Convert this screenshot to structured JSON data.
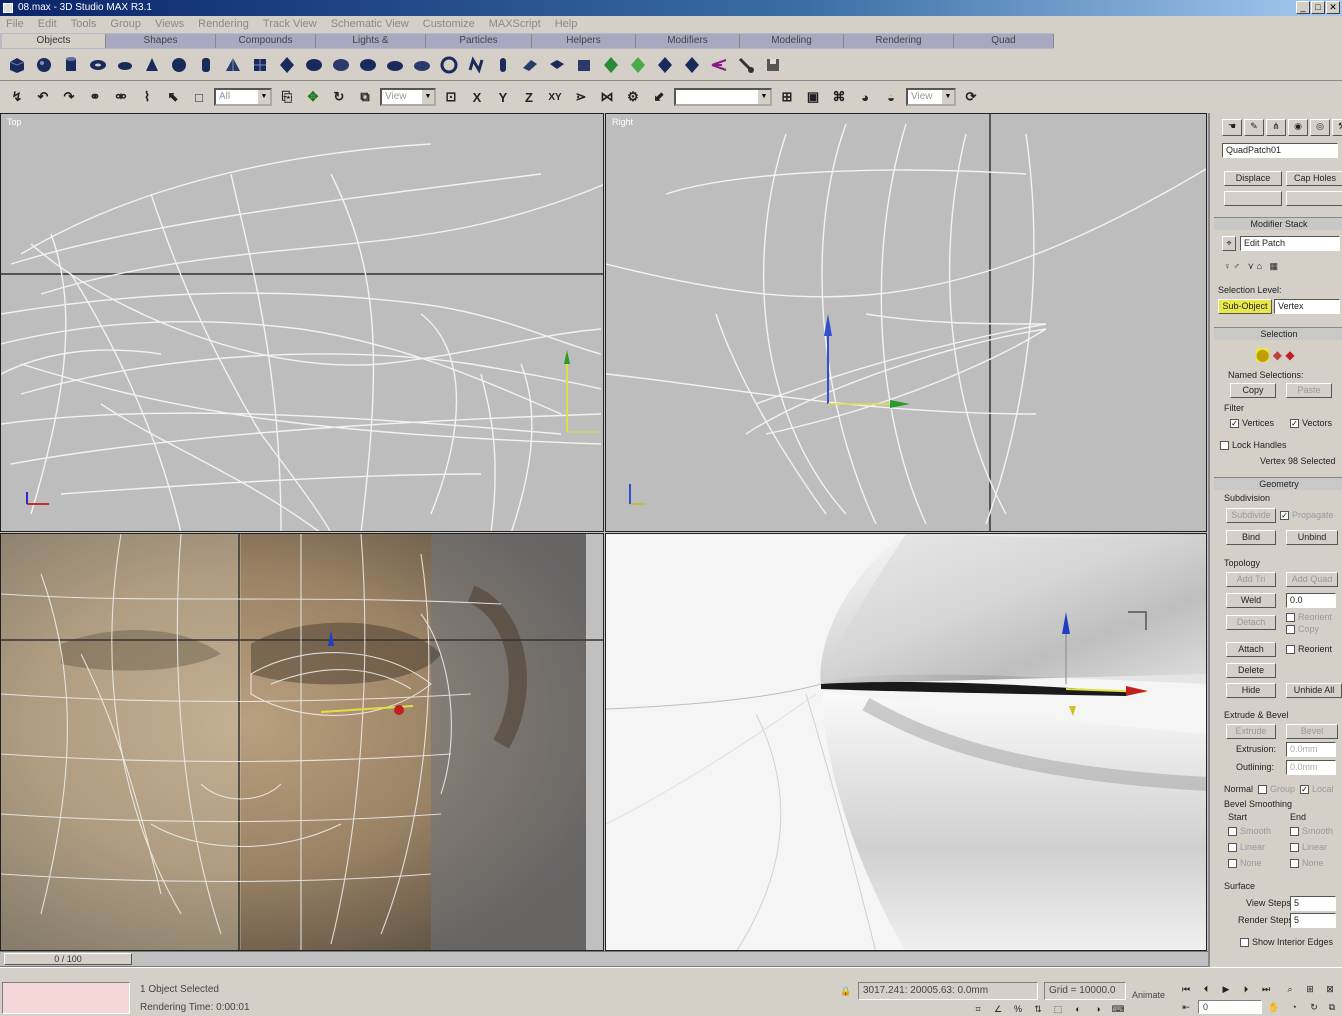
{
  "window": {
    "title": "08.max - 3D Studio MAX R3.1",
    "min": "_",
    "max": "□",
    "close": "✕"
  },
  "menu": [
    "File",
    "Edit",
    "Tools",
    "Group",
    "Views",
    "Rendering",
    "Track View",
    "Schematic View",
    "Customize",
    "MAXScript",
    "Help"
  ],
  "tabs": [
    "Objects",
    "Shapes",
    "Compounds",
    "Lights & Cameras",
    "Particles",
    "Helpers",
    "Modifiers",
    "Modeling",
    "Rendering",
    "Quad Meshes"
  ],
  "toolbar": {
    "selection_filter": "All",
    "ref_coord": "View",
    "named_sel": "",
    "view_dd": "View",
    "axis_x": "X",
    "axis_y": "Y",
    "axis_z": "Z",
    "axis_xy": "XY"
  },
  "viewports": {
    "top": "Top",
    "right": "Right",
    "front": "",
    "perspective": ""
  },
  "command_panel": {
    "object_name": "QuadPatch01",
    "displace": "Displace",
    "cap_holes": "Cap Holes",
    "modifier_stack_title": "Modifier Stack",
    "stack_item": "Edit Patch",
    "selection_level_label": "Selection Level:",
    "sub_object": "Sub-Object",
    "sub_level": "Vertex",
    "selection_title": "Selection",
    "named_selections": "Named Selections:",
    "copy": "Copy",
    "paste": "Paste",
    "filter": "Filter",
    "vertices": "Vertices",
    "vectors": "Vectors",
    "lock_handles": "Lock Handles",
    "vertex_selected": "Vertex 98 Selected",
    "geometry_title": "Geometry",
    "subdivision": "Subdivision",
    "subdivide": "Subdivide",
    "propagate": "Propagate",
    "bind": "Bind",
    "unbind": "Unbind",
    "topology": "Topology",
    "add_tri": "Add Tri",
    "add_quad": "Add Quad",
    "weld": "Weld",
    "weld_value": "0.0",
    "detach": "Detach",
    "reorient": "Reorient",
    "copy2": "Copy",
    "attach": "Attach",
    "reorient2": "Reorient",
    "delete": "Delete",
    "hide": "Hide",
    "unhide_all": "Unhide All",
    "extrude_bevel": "Extrude & Bevel",
    "extrude_btn": "Extrude",
    "bevel_btn": "Bevel",
    "extrusion": "Extrusion:",
    "extrusion_val": "0.0mm",
    "outlining": "Outlining:",
    "outlining_val": "0.0mm",
    "normal": "Normal",
    "group": "Group",
    "local": "Local",
    "bevel_smoothing": "Bevel Smoothing",
    "start": "Start",
    "end": "End",
    "smooth": "Smooth",
    "linear": "Linear",
    "none": "None",
    "surface": "Surface",
    "view_steps": "View Steps:",
    "view_steps_val": "5",
    "render_steps": "Render Steps:",
    "render_steps_val": "5",
    "show_interior_edges": "Show Interior Edges"
  },
  "timeline": {
    "position": "0 / 100"
  },
  "status": {
    "selected": "1 Object Selected",
    "render_time": "Rendering Time: 0:00:01",
    "coords": "3017.241: 20005.63: 0.0mm",
    "grid": "Grid = 10000.0",
    "animate": "Animate",
    "frame": "0"
  },
  "colors": {
    "accent": "#0a246a",
    "viewport_bg": "#bdbdbd",
    "wire": "#ffffff"
  }
}
